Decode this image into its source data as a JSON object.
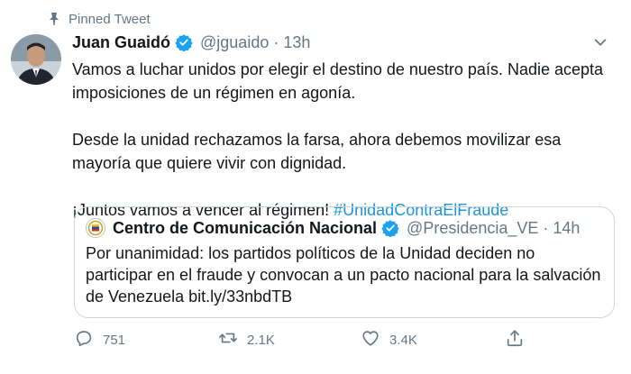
{
  "pinned": {
    "label": "Pinned Tweet"
  },
  "tweet": {
    "author_name": "Juan Guaidó",
    "handle": "@jguaido",
    "separator": "·",
    "time": "13h",
    "paragraph1": "Vamos a luchar unidos por elegir el destino de nuestro país. Nadie acepta imposiciones de un régimen en agonía.",
    "paragraph2": "Desde la unidad rechazamos la farsa, ahora debemos movilizar esa mayoría que quiere vivir con dignidad.",
    "paragraph3_prefix": "¡Juntos vamos a vencer al régimen! ",
    "hashtag": "#UnidadContraElFraude",
    "verified": true
  },
  "quoted_tweet": {
    "author_name": "Centro de Comunicación Nacional",
    "handle": "@Presidencia_VE",
    "separator": "·",
    "time": "14h",
    "text": "Por unanimidad: los partidos políticos de la Unidad deciden no participar en el fraude y convocan a un pacto nacional para la salvación de Venezuela bit.ly/33nbdTB",
    "verified": true
  },
  "actions": {
    "replies": "751",
    "retweets": "2.1K",
    "likes": "3.4K"
  },
  "colors": {
    "text": "#14171a",
    "muted": "#657786",
    "accent": "#1b95e0",
    "border": "#ccd6dd"
  },
  "icons": [
    "pin-icon",
    "verified-icon",
    "chevron-down-icon",
    "reply-icon",
    "retweet-icon",
    "like-icon",
    "share-icon"
  ]
}
